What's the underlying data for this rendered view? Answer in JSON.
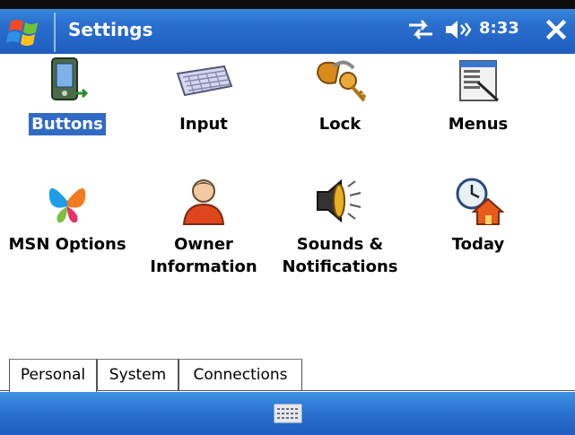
{
  "window": {
    "title": "Settings",
    "time": "8:33"
  },
  "items": [
    {
      "label": "Buttons",
      "selected": true
    },
    {
      "label": "Input"
    },
    {
      "label": "Lock"
    },
    {
      "label": "Menus"
    },
    {
      "label": "MSN Options"
    },
    {
      "label": "Owner Information",
      "line1": "Owner",
      "line2": "Information"
    },
    {
      "label": "Sounds & Notifications",
      "line1": "Sounds &",
      "line2": "Notifications"
    },
    {
      "label": "Today"
    }
  ],
  "tabs": [
    {
      "label": "Personal",
      "active": true
    },
    {
      "label": "System"
    },
    {
      "label": "Connections"
    }
  ],
  "icons": {
    "start": "windows-flag-icon",
    "connectivity": "connectivity-arrows-icon",
    "volume": "speaker-icon",
    "close": "close-icon",
    "sip": "keyboard-icon"
  }
}
